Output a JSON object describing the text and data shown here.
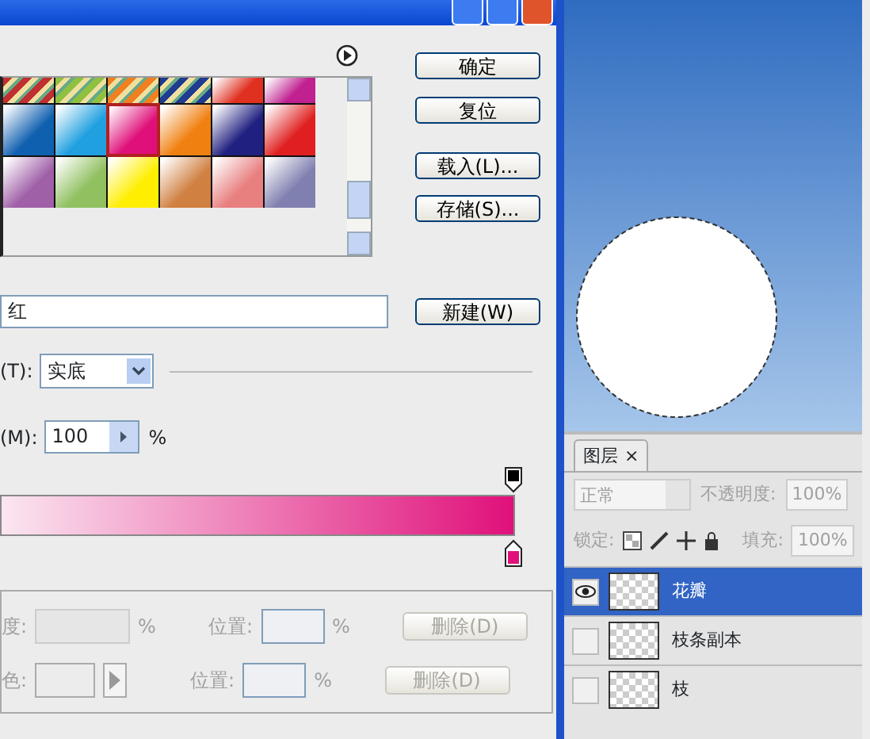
{
  "dialog": {
    "presets": [
      {
        "kind": "stripes",
        "color": "#c03030",
        "selected": false
      },
      {
        "kind": "stripes",
        "color": "#90c040",
        "selected": false
      },
      {
        "kind": "stripes",
        "color": "#f08020",
        "selected": false
      },
      {
        "kind": "stripes",
        "color": "#203c90",
        "selected": false
      },
      {
        "kind": "gradient",
        "color": "#e03020",
        "selected": false
      },
      {
        "kind": "gradient",
        "color": "#c02090",
        "selected": false
      },
      {
        "kind": "gradient",
        "color": "#1060b0",
        "selected": false
      },
      {
        "kind": "gradient",
        "color": "#20a0e0",
        "selected": false
      },
      {
        "kind": "gradient",
        "color": "#e0107a",
        "selected": true
      },
      {
        "kind": "gradient",
        "color": "#f08010",
        "selected": false
      },
      {
        "kind": "gradient",
        "color": "#202080",
        "selected": false
      },
      {
        "kind": "gradient",
        "color": "#e02020",
        "selected": false
      },
      {
        "kind": "gradient",
        "color": "#a060a8",
        "selected": false
      },
      {
        "kind": "gradient",
        "color": "#90c060",
        "selected": false
      },
      {
        "kind": "gradient",
        "color": "#ffee00",
        "selected": false
      },
      {
        "kind": "gradient",
        "color": "#d08040",
        "selected": false
      },
      {
        "kind": "gradient",
        "color": "#e88080",
        "selected": false
      },
      {
        "kind": "gradient",
        "color": "#8080b0",
        "selected": false
      }
    ],
    "buttons": [
      "确定",
      "复位",
      "载入(L)...",
      "存储(S)..."
    ],
    "name_field": {
      "value": "红"
    },
    "new_button": "新建(W)",
    "type_label": "(T):",
    "type_value": "实底",
    "smoothness_label": "(M):",
    "smoothness_value": "100",
    "smoothness_unit": "%",
    "stop_rows": [
      {
        "kind": "opacity",
        "label": "度:",
        "unit": "%",
        "position_label": "位置:",
        "position_unit": "%",
        "delete_button": "删除(D)",
        "disabled": true
      },
      {
        "kind": "color",
        "label": "色:",
        "position_label": "位置:",
        "position_unit": "%",
        "delete_button": "删除(D)",
        "disabled": true
      }
    ]
  },
  "layers_panel": {
    "tab": "图层",
    "close": "×",
    "blend_mode": "正常",
    "opacity_label": "不透明度:",
    "opacity_value": "100%",
    "lock_label": "锁定:",
    "fill_label": "填充:",
    "fill_value": "100%",
    "layers": [
      {
        "name": "花瓣",
        "visible": true,
        "selected": true
      },
      {
        "name": "枝条副本",
        "visible": false,
        "selected": false
      },
      {
        "name": "枝",
        "visible": false,
        "selected": false
      }
    ]
  }
}
